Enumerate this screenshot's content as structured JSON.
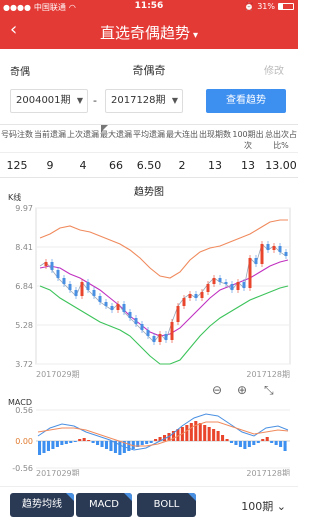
{
  "status_bar": {
    "carrier": "中国联通",
    "time": "11:56",
    "battery": "31%"
  },
  "header": {
    "back_icon": "back-arrow-icon",
    "title": "直选奇偶趋势",
    "chevron": "▾"
  },
  "filter": {
    "type_label": "奇偶",
    "type_value": "奇偶奇",
    "edit_label": "修改"
  },
  "range": {
    "start": "2004001期",
    "end": "2017128期",
    "separator": "-",
    "button": "查看趋势"
  },
  "stats": {
    "columns": [
      {
        "header": "号码注数",
        "value": "125"
      },
      {
        "header": "当前遗漏",
        "value": "9"
      },
      {
        "header": "上次遗漏",
        "value": "4"
      },
      {
        "header": "最大遗漏",
        "value": "66"
      },
      {
        "header": "平均遗漏",
        "value": "6.50"
      },
      {
        "header": "最大连出",
        "value": "2"
      },
      {
        "header": "出现期数",
        "value": "13"
      },
      {
        "header": "100期出次",
        "value": "13"
      },
      {
        "header": "总出次占比%",
        "value": "13.00"
      }
    ]
  },
  "kline": {
    "title": "趋势图",
    "label": "K线",
    "y_ticks": [
      "9.97",
      "8.41",
      "6.84",
      "5.28",
      "3.72"
    ],
    "x_start": "2017029期",
    "x_end": "2017128期"
  },
  "macd": {
    "label": "MACD",
    "y_ticks": [
      "0.56",
      "0.00",
      "-0.56"
    ],
    "x_start": "2017029期",
    "x_end": "2017128期"
  },
  "zoom": {
    "zoom_out_icon": "zoom-out-icon",
    "zoom_in_icon": "zoom-in-icon",
    "expand_icon": "expand-icon"
  },
  "bottom": {
    "tabs": [
      "趋势均线",
      "MACD",
      "BOLL"
    ],
    "periods": "100期"
  },
  "colors": {
    "primary": "#e43a36",
    "button": "#3d8ff0",
    "tab": "#2a3a55",
    "upper_band": "#f08a5d",
    "lower_band": "#3cc35a",
    "ma": "#c030c0",
    "candle_up": "#e8452c",
    "candle_down": "#4a90e2"
  }
}
